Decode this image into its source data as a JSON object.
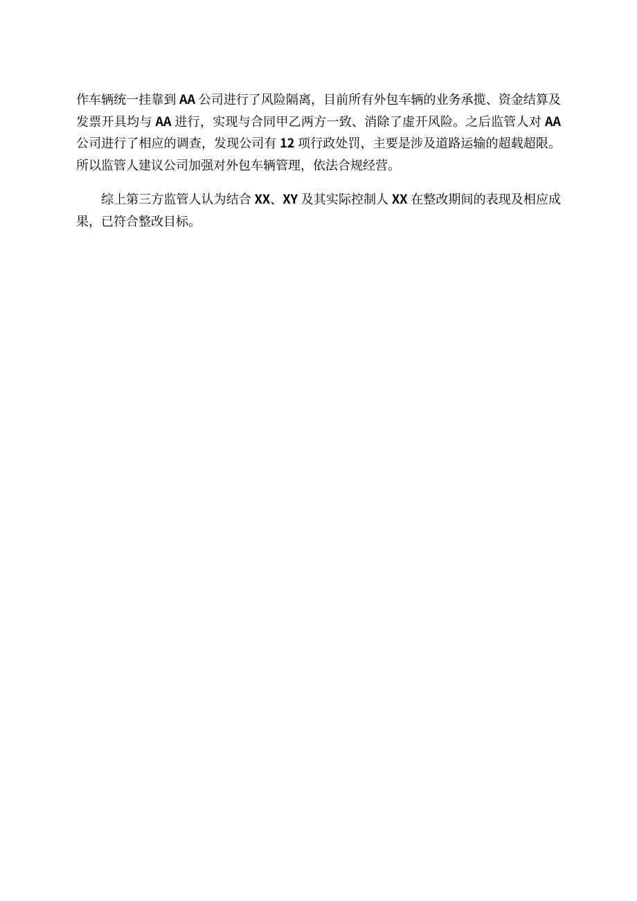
{
  "para1": {
    "seg1": "作车辆统一挂靠到 ",
    "b1": "AA",
    "seg2": " 公司进行了风险隔离，目前所有外包车辆的业务承揽、资金结算及发票开具均与 ",
    "b2": "AA",
    "seg3": " 进行，实现与合同甲乙两方一致、消除了虚开风险。之后监管人对 ",
    "b3": "AA",
    "seg4": " 公司进行了相应的调查，发现公司有 ",
    "b4": "12",
    "seg5": " 项行政处罚，主要是涉及道路运输的超载超限。所以监管人建议公司加强对外包车辆管理，依法合规经营。"
  },
  "para2": {
    "seg1": "综上第三方监管人认为结合 ",
    "b1": "XX",
    "seg2": "、",
    "b2": "XY",
    "seg3": " 及其实际控制人 ",
    "b3": "XX",
    "seg4": " 在整改期间的表现及相应成果，已符合整改目标。"
  }
}
